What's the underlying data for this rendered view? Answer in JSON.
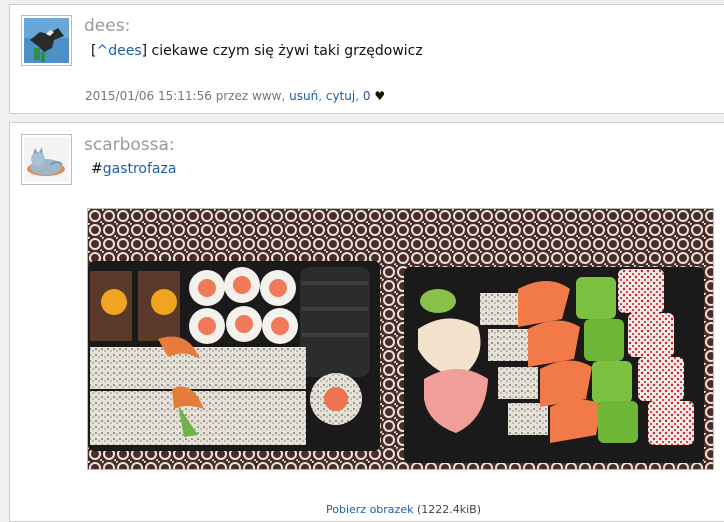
{
  "posts": [
    {
      "username": "dees:",
      "mention_open": "[",
      "mention": "^dees",
      "mention_close": "]",
      "text": " ciekawe czym się żywi taki grzędowicz",
      "timestamp": "2015/01/06 15:11:56",
      "by_text": "przez www,",
      "delete_label": "usuń",
      "quote_label": "cytuj",
      "likes": "0",
      "avatar_icon": "eagle-icon"
    },
    {
      "username": "scarbossa:",
      "hash": "#",
      "tag": "gastrofaza",
      "image_caption_link": "Pobierz obrazek",
      "image_size": "(1222.4kiB)",
      "avatar_icon": "cat-icon"
    }
  ],
  "colors": {
    "link": "#1d5ea8",
    "username": "#9a9a9a",
    "meta": "#777777"
  }
}
